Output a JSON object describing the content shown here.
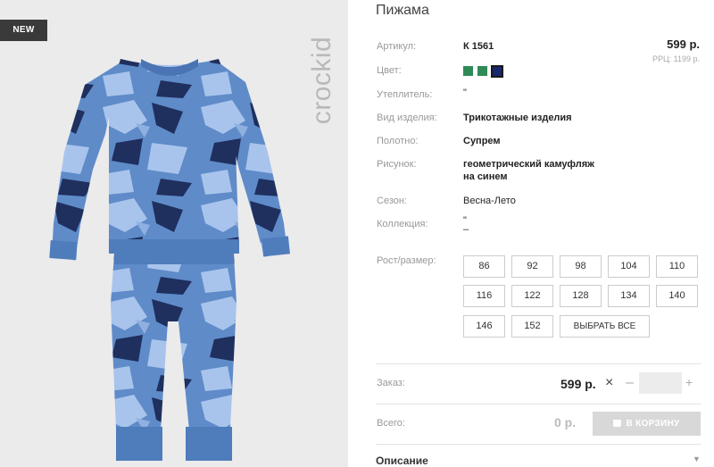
{
  "product": {
    "badge": "NEW",
    "brand": "crockid",
    "title": "Пижама",
    "price": "599 р.",
    "rrp": "РРЦ: 1199 р."
  },
  "specs": [
    {
      "label": "Артикул:",
      "value": "К 1561"
    },
    {
      "label": "Цвет:",
      "value": ""
    },
    {
      "label": "Утеплитель:",
      "value": "\""
    },
    {
      "label": "Вид изделия:",
      "value": "Трикотажные изделия"
    },
    {
      "label": "Полотно:",
      "value": "Супрем"
    },
    {
      "label": "Рисунок:",
      "value": "геометрический камуфляж",
      "value2": "на синем"
    },
    {
      "label": "Сезон:",
      "value": "Весна-Лето"
    },
    {
      "label": "Коллекция:",
      "value": "\"",
      "value2": "–"
    }
  ],
  "colors": {
    "swatches": [
      "#2e8b57",
      "#2e8b57",
      "#1a2670"
    ],
    "selected_index": 2
  },
  "sizes": {
    "label": "Рост/размер:",
    "options": [
      "86",
      "92",
      "98",
      "104",
      "110",
      "116",
      "122",
      "128",
      "134",
      "140",
      "146",
      "152"
    ],
    "select_all": "ВЫБРАТЬ ВСЕ"
  },
  "order": {
    "label": "Заказ:",
    "price": "599 р.",
    "times": "×",
    "minus": "–",
    "plus": "+",
    "qty": ""
  },
  "total": {
    "label": "Всего:",
    "value": "0 р.",
    "cart_button": "В КОРЗИНУ"
  },
  "description": {
    "label": "Описание",
    "chevron": "▼"
  }
}
